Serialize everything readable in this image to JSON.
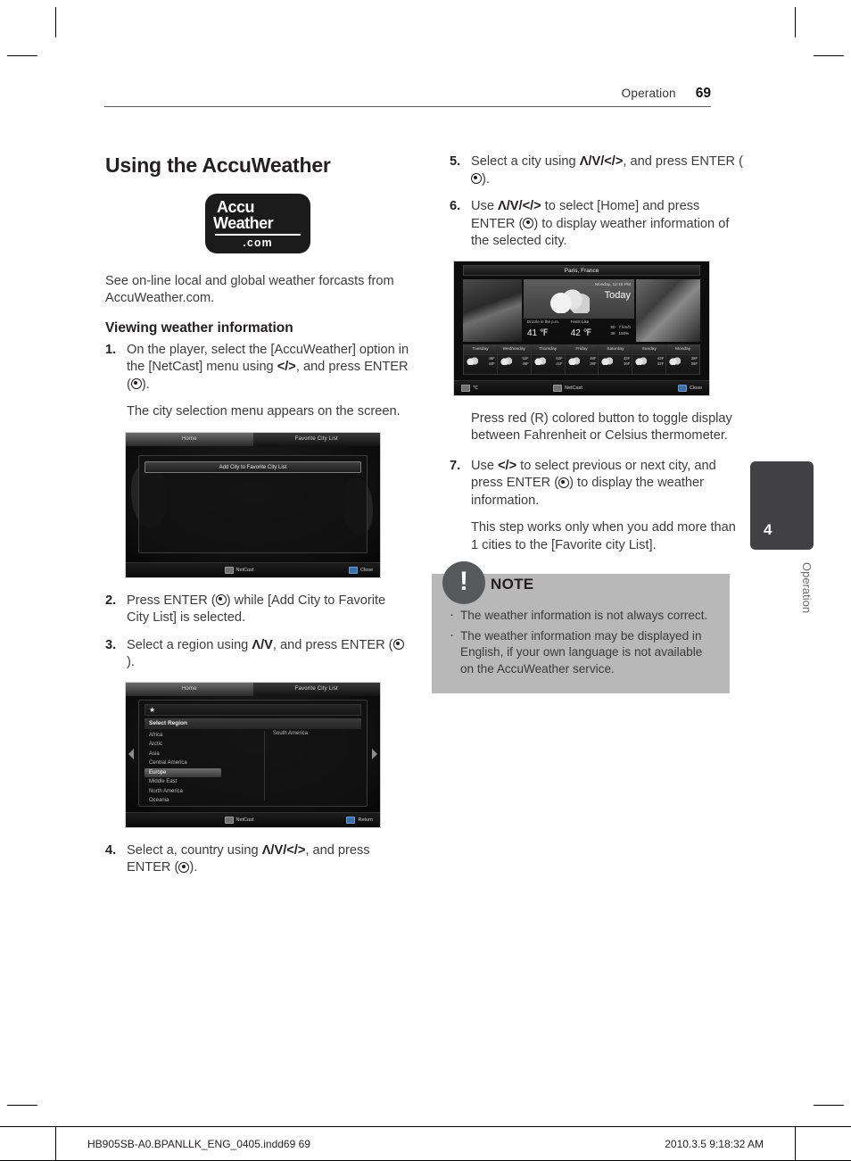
{
  "header": {
    "section": "Operation",
    "page_number": "69"
  },
  "left_column": {
    "title": "Using the AccuWeather",
    "logo": {
      "line1": "Accu",
      "line2": "Weather",
      "line3": ".com"
    },
    "intro": "See on-line local and global weather forcasts from AccuWeather.com.",
    "subtitle": "Viewing weather information",
    "steps": [
      {
        "num": "1.",
        "text_pre": "On the player, select the [AccuWeather] option in the [NetCast] menu using ",
        "arrows": "</>",
        "text_mid": ", and press ENTER (",
        "text_post": ").",
        "note": "The city selection menu appears on the screen."
      },
      {
        "num": "2.",
        "text_pre": "Press ENTER (",
        "arrows": "",
        "text_mid": "",
        "text_post": ") while [Add City to Favorite City List] is selected."
      },
      {
        "num": "3.",
        "text_pre": "Select a region using ",
        "arrows": "Λ/V",
        "text_mid": ", and press ENTER (",
        "text_post": ")."
      },
      {
        "num": "4.",
        "text_pre": "Select a, country using ",
        "arrows": "Λ/V/</>",
        "text_mid": ", and press ENTER (",
        "text_post": ")."
      }
    ],
    "screenshot_favorites": {
      "tab_home": "Home",
      "tab_favorite": "Favorite City List",
      "add_button": "Add City to Favorite City List",
      "footer_center": "NetCast",
      "footer_right": "Close"
    },
    "screenshot_region": {
      "tab_home": "Home",
      "tab_favorite": "Favorite City List",
      "select_region_label": "Select Region",
      "regions": [
        "Africa",
        "Arctic",
        "Asia",
        "Central America",
        "Europe",
        "Middle East",
        "North America",
        "Oceania"
      ],
      "selected_region": "Europe",
      "region_second_column": "South America",
      "footer_center": "NetCast",
      "footer_right": "Return"
    }
  },
  "right_column": {
    "steps": [
      {
        "num": "5.",
        "text_pre": "Select a city using ",
        "arrows": "Λ/V/</>",
        "text_mid": ", and press ENTER (",
        "text_post": ")."
      },
      {
        "num": "6.",
        "text_pre": "Use ",
        "arrows": "Λ/V/</>",
        "text_mid": " to select [Home] and press ENTER (",
        "text_post": ") to display weather information of the selected city."
      },
      {
        "num": "7.",
        "text_pre": "Use ",
        "arrows": "</>",
        "text_mid": " to select previous or next city, and press ENTER (",
        "text_post": ") to display the weather information.",
        "note": "This step works only when you add more than 1 cities to the [Favorite city List]."
      }
    ],
    "red_button_note": "Press red (R) colored button to toggle display between Fahrenheit or Celsius thermometer.",
    "screenshot_weather": {
      "city": "Paris, France",
      "datetime": "Monday, 12:15 PM",
      "today_label": "Today",
      "condition": "Drizzle in the p.m.",
      "temperature": "41 ℉",
      "feels_like_label": "Feels Like",
      "feels_like": "42 ℉",
      "hi_lo_hi": "50",
      "hi_lo_lo": "38",
      "wind": "7 km/h",
      "humidity": "100%",
      "forecast": [
        {
          "day": "Tuesday",
          "hi": "46F",
          "lo": "44F"
        },
        {
          "day": "Wednesday",
          "hi": "52F",
          "lo": "46F"
        },
        {
          "day": "Thursday",
          "hi": "52F",
          "lo": "41F"
        },
        {
          "day": "Friday",
          "hi": "48F",
          "lo": "28F"
        },
        {
          "day": "Saturday",
          "hi": "45F",
          "lo": "26F"
        },
        {
          "day": "Sunday",
          "hi": "43F",
          "lo": "32F"
        },
        {
          "day": "Monday",
          "hi": "38F",
          "lo": "26F"
        }
      ],
      "footer_left": "℃",
      "footer_center": "NetCast",
      "footer_right": "Close"
    },
    "note_box": {
      "title": "NOTE",
      "badge": "!",
      "items": [
        "The weather information is not always correct.",
        "The weather information may be displayed in English, if your own language is not available on the AccuWeather service."
      ]
    }
  },
  "side_tab": {
    "number": "4",
    "label": "Operation"
  },
  "page_footer": {
    "left": "HB905SB-A0.BPANLLK_ENG_0405.indd69   69",
    "right": "2010.3.5   9:18:32 AM"
  }
}
